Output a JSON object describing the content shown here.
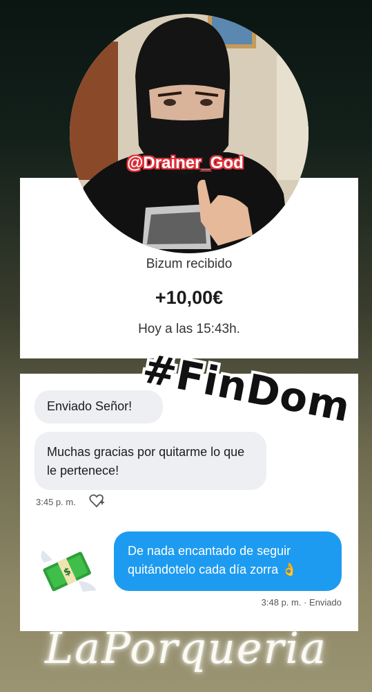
{
  "profile": {
    "handle": "@Drainer_God"
  },
  "bizum": {
    "label": "Bizum recibido",
    "amount": "+10,00€",
    "time": "Hoy a las 15:43h."
  },
  "sticker": {
    "hashtag": "#FinDom"
  },
  "chat": {
    "incoming": [
      "Enviado Señor!",
      "Muchas gracias por quitarme lo que le pertenece!"
    ],
    "incoming_timestamp": "3:45 p. m.",
    "outgoing": "De nada encantado de seguir quitándotelo cada día zorra 👌",
    "outgoing_timestamp": "3:48 p. m. · Enviado"
  },
  "watermark": "LaPorqueria",
  "colors": {
    "outgoing_bubble": "#1d9bf0",
    "incoming_bubble": "#edeff2",
    "handle_outline": "#e0303a"
  },
  "icons": [
    "heart-plus-icon",
    "money-with-wings-icon"
  ]
}
